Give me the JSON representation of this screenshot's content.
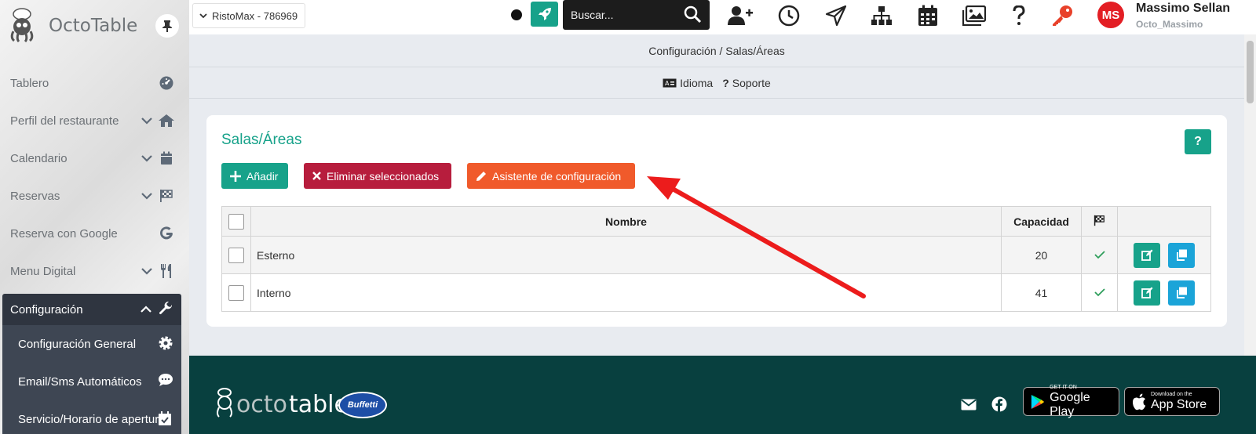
{
  "app": {
    "brand": "OctoTable"
  },
  "sidebar": {
    "items": [
      {
        "label": "Tablero",
        "icon": "dashboard-icon"
      },
      {
        "label": "Perfil del restaurante",
        "icon": "home-icon"
      },
      {
        "label": "Calendario",
        "icon": "calendar-icon"
      },
      {
        "label": "Reservas",
        "icon": "flag-checkered-icon"
      },
      {
        "label": "Reserva con Google",
        "icon": "google-icon"
      },
      {
        "label": "Menu Digital",
        "icon": "utensils-icon"
      }
    ],
    "active": {
      "label": "Configuración",
      "icon": "wrench-icon"
    },
    "submenu": [
      {
        "label": "Configuración General",
        "icon": "gear-icon"
      },
      {
        "label": "Email/Sms Automáticos",
        "icon": "comment-icon"
      },
      {
        "label": "Servicio/Horario de apertura",
        "icon": "calendar-check-icon"
      }
    ]
  },
  "topbar": {
    "restaurant": "RistoMax - 786969",
    "search_placeholder": "Buscar...",
    "user_initials": "MS",
    "user_name": "Massimo Sellan",
    "user_account": "Octo_Massimo"
  },
  "breadcrumb": "Configuración / Salas/Áreas",
  "links": {
    "language": "Idioma",
    "support": "Soporte"
  },
  "card": {
    "title": "Salas/Áreas",
    "help_label": "?",
    "buttons": {
      "add": "Añadir",
      "delete": "Eliminar seleccionados",
      "wizard": "Asistente de configuración"
    },
    "table": {
      "headers": {
        "name": "Nombre",
        "capacity": "Capacidad"
      },
      "rows": [
        {
          "name": "Esterno",
          "capacity": "20",
          "active": true
        },
        {
          "name": "Interno",
          "capacity": "41",
          "active": true
        }
      ]
    }
  },
  "footer": {
    "logo_a": "octo",
    "logo_b": "table",
    "partner": "Buffetti",
    "google_play_small": "GET IT ON",
    "google_play_big": "Google Play",
    "app_store_small": "Download on the",
    "app_store_big": "App Store"
  },
  "colors": {
    "accent": "#17a28a",
    "danger": "#b71d3d",
    "wizard": "#f05a2b",
    "footer": "#08403f",
    "avatar": "#e31e24"
  }
}
